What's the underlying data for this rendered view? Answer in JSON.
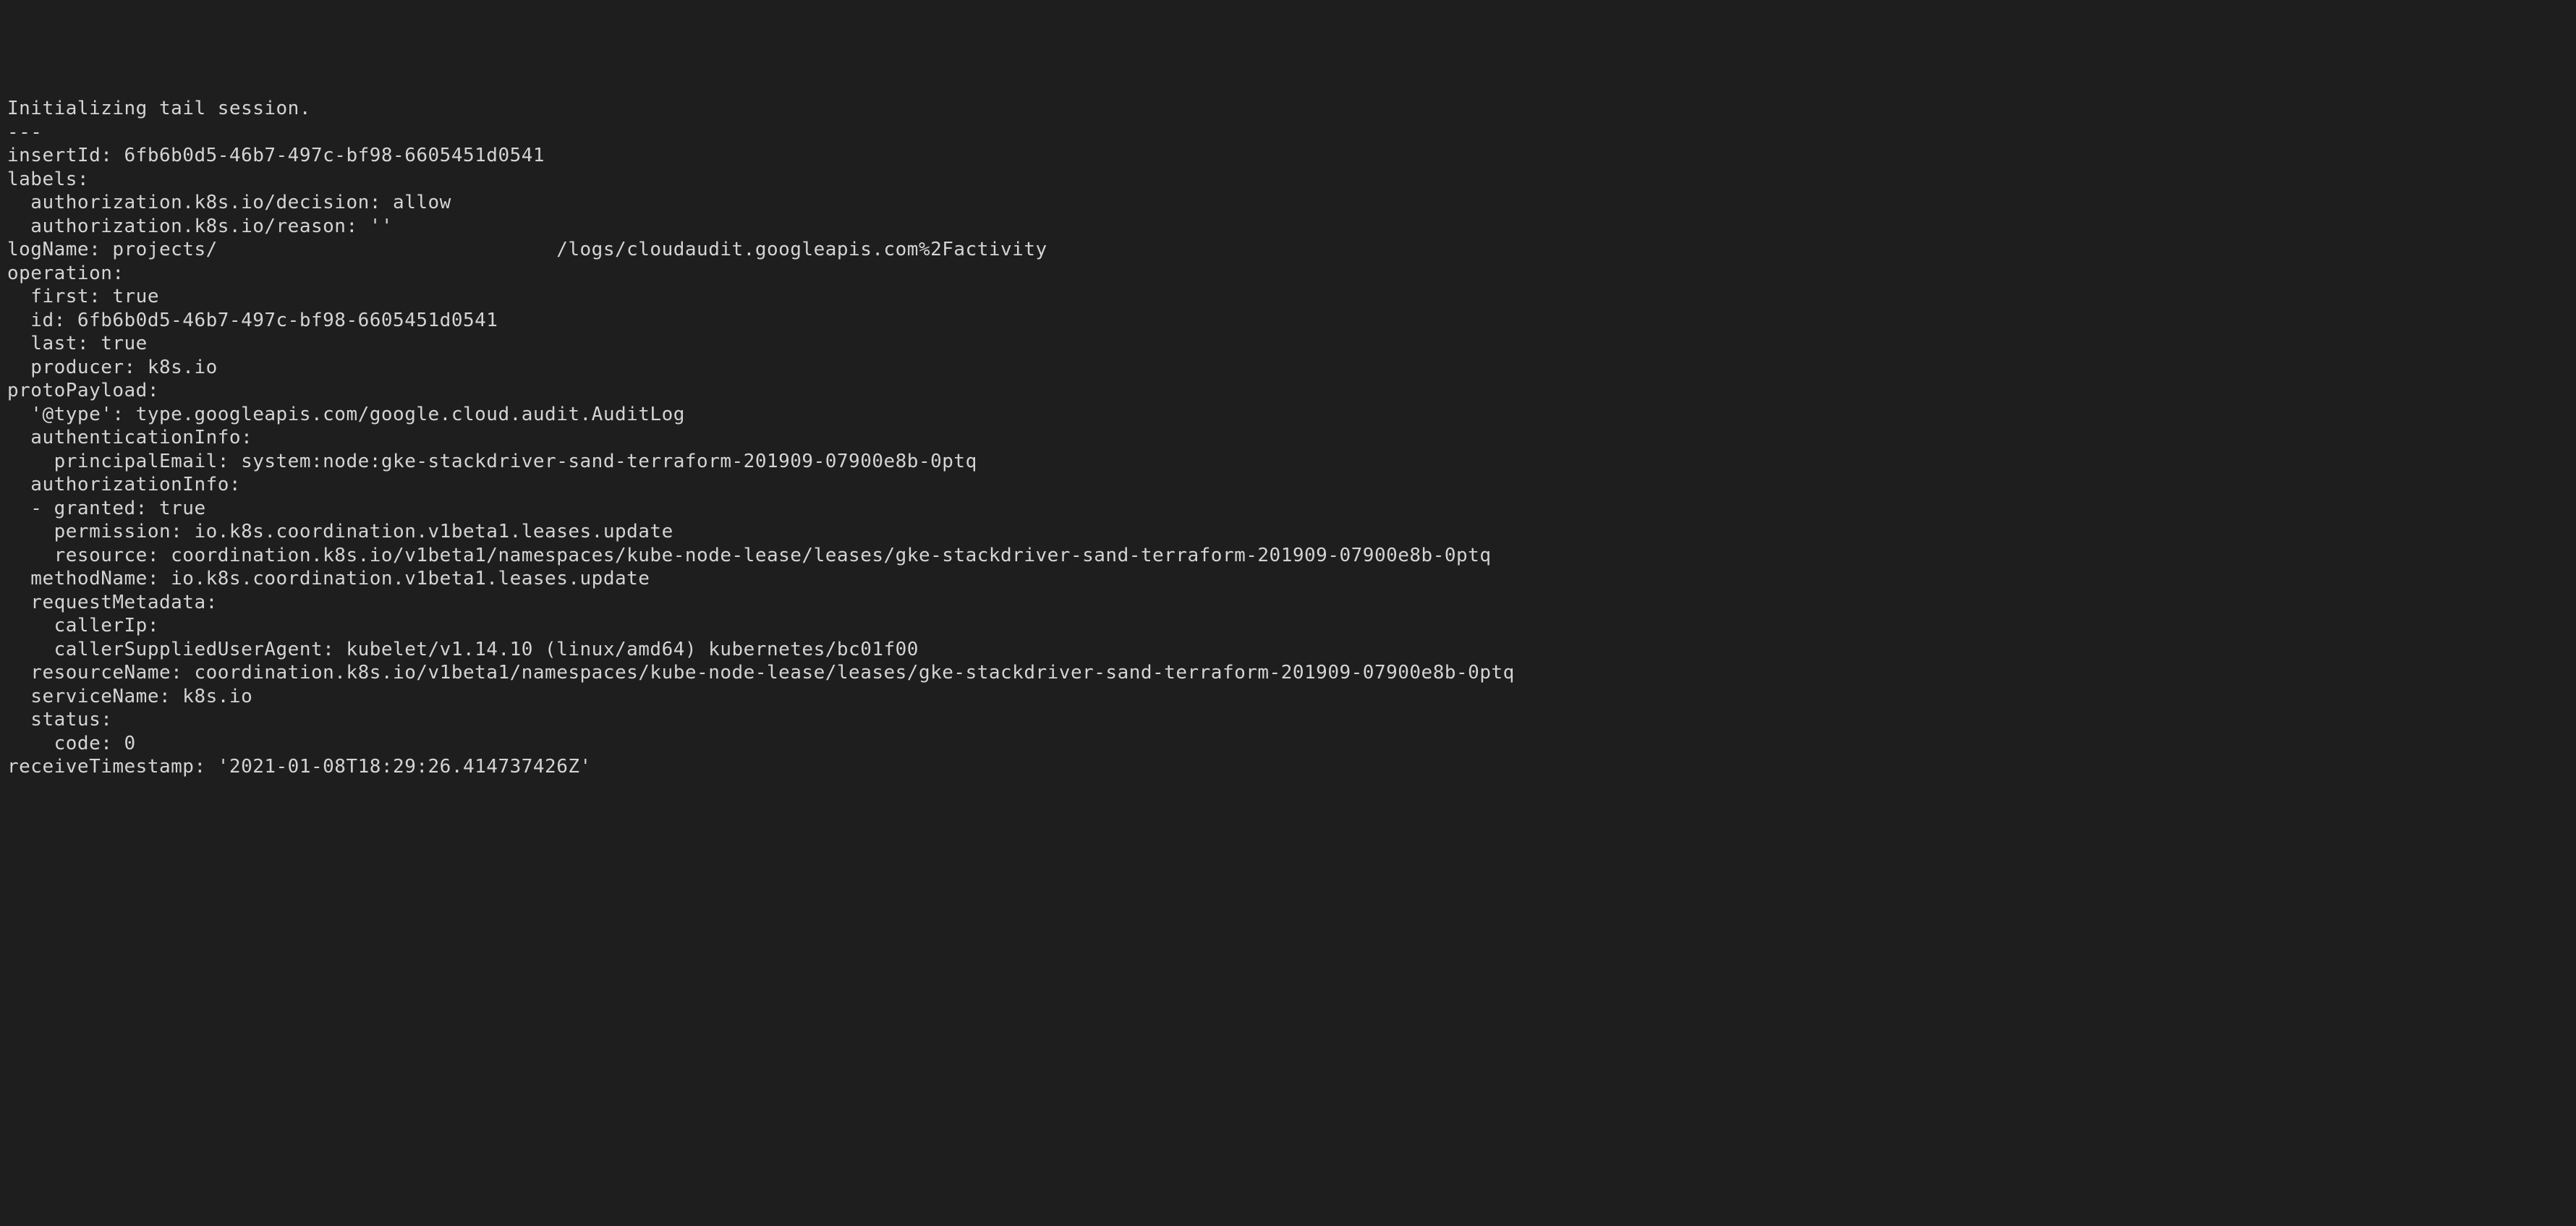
{
  "terminal": {
    "lines": [
      "Initializing tail session.",
      "---",
      "insertId: 6fb6b0d5-46b7-497c-bf98-6605451d0541",
      "labels:",
      "  authorization.k8s.io/decision: allow",
      "  authorization.k8s.io/reason: ''",
      "logName: projects/                             /logs/cloudaudit.googleapis.com%2Factivity",
      "operation:",
      "  first: true",
      "  id: 6fb6b0d5-46b7-497c-bf98-6605451d0541",
      "  last: true",
      "  producer: k8s.io",
      "protoPayload:",
      "  '@type': type.googleapis.com/google.cloud.audit.AuditLog",
      "  authenticationInfo:",
      "    principalEmail: system:node:gke-stackdriver-sand-terraform-201909-07900e8b-0ptq",
      "  authorizationInfo:",
      "  - granted: true",
      "    permission: io.k8s.coordination.v1beta1.leases.update",
      "    resource: coordination.k8s.io/v1beta1/namespaces/kube-node-lease/leases/gke-stackdriver-sand-terraform-201909-07900e8b-0ptq",
      "  methodName: io.k8s.coordination.v1beta1.leases.update",
      "  requestMetadata:",
      "    callerIp:",
      "    callerSuppliedUserAgent: kubelet/v1.14.10 (linux/amd64) kubernetes/bc01f00",
      "  resourceName: coordination.k8s.io/v1beta1/namespaces/kube-node-lease/leases/gke-stackdriver-sand-terraform-201909-07900e8b-0ptq",
      "  serviceName: k8s.io",
      "  status:",
      "    code: 0",
      "receiveTimestamp: '2021-01-08T18:29:26.414737426Z'"
    ]
  }
}
